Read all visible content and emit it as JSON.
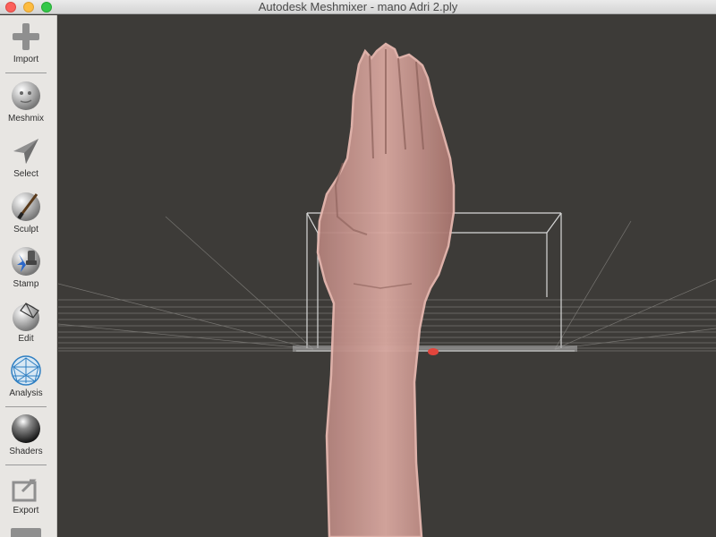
{
  "window": {
    "title": "Autodesk Meshmixer - mano Adri 2.ply"
  },
  "toolbar": {
    "items": [
      {
        "label": "Import",
        "icon": "plus-icon"
      },
      {
        "label": "Meshmix",
        "icon": "face-sphere-icon"
      },
      {
        "label": "Select",
        "icon": "arrow-cursor-icon"
      },
      {
        "label": "Sculpt",
        "icon": "brush-sphere-icon"
      },
      {
        "label": "Stamp",
        "icon": "stamp-sphere-icon"
      },
      {
        "label": "Edit",
        "icon": "edit-sphere-icon"
      },
      {
        "label": "Analysis",
        "icon": "mesh-sphere-icon"
      },
      {
        "label": "Shaders",
        "icon": "chrome-sphere-icon"
      },
      {
        "label": "Export",
        "icon": "export-icon"
      }
    ]
  },
  "viewport": {
    "model": "hand mesh",
    "background": "#3d3b38",
    "mesh_color": "#c99a93"
  }
}
